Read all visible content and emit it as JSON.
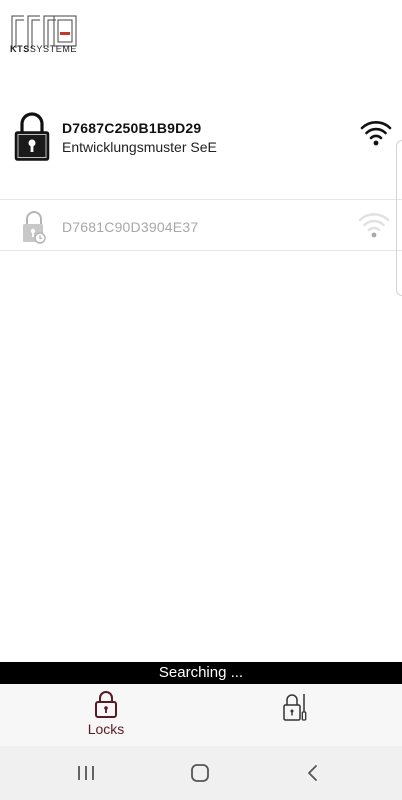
{
  "header": {
    "logo_brand": "KTS",
    "logo_suffix": "SYSTEME"
  },
  "locks": [
    {
      "id": "D7687C250B1B9D29",
      "name": "Entwicklungsmuster SeE",
      "signal": "strong"
    },
    {
      "id": "D7681C90D3904E37",
      "name": "",
      "signal": "weak"
    }
  ],
  "status": {
    "text": "Searching ..."
  },
  "tabs": [
    {
      "label": "Locks",
      "icon": "lock-icon",
      "selected": true
    },
    {
      "label": "",
      "icon": "lock-tools-icon",
      "selected": false
    }
  ],
  "system_nav": {
    "icons": [
      "recents-icon",
      "home-icon",
      "back-icon"
    ]
  },
  "colors": {
    "accent": "#5a1a24",
    "logo_red": "#c0392b",
    "status_bg": "#000000",
    "dim_text": "#a8a8a8"
  }
}
